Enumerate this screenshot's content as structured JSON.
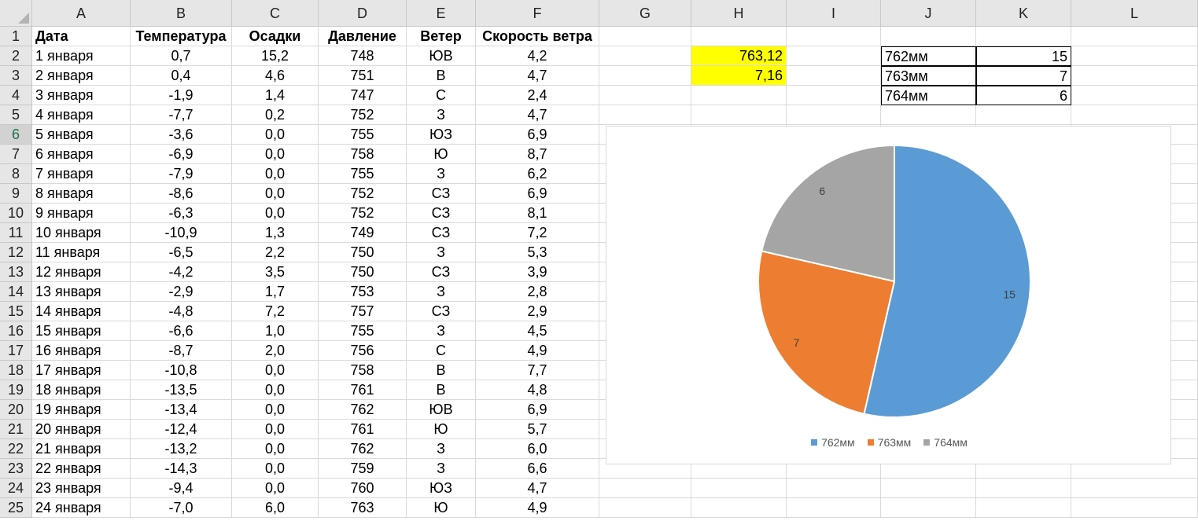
{
  "column_headers": [
    "A",
    "B",
    "C",
    "D",
    "E",
    "F",
    "G",
    "H",
    "I",
    "J",
    "K",
    "L"
  ],
  "row_numbers": [
    "1",
    "2",
    "3",
    "4",
    "5",
    "6",
    "7",
    "8",
    "9",
    "10",
    "11",
    "12",
    "13",
    "14",
    "15",
    "16",
    "17",
    "18",
    "19",
    "20",
    "21",
    "22",
    "23",
    "24",
    "25"
  ],
  "table": {
    "headers": [
      "Дата",
      "Температура",
      "Осадки",
      "Давление",
      "Ветер",
      "Скорость ветра"
    ],
    "rows": [
      [
        "1 января",
        "0,7",
        "15,2",
        "748",
        "ЮВ",
        "4,2"
      ],
      [
        "2 января",
        "0,4",
        "4,6",
        "751",
        "В",
        "4,7"
      ],
      [
        "3 января",
        "-1,9",
        "1,4",
        "747",
        "С",
        "2,4"
      ],
      [
        "4 января",
        "-7,7",
        "0,2",
        "752",
        "З",
        "4,7"
      ],
      [
        "5 января",
        "-3,6",
        "0,0",
        "755",
        "ЮЗ",
        "6,9"
      ],
      [
        "6 января",
        "-6,9",
        "0,0",
        "758",
        "Ю",
        "8,7"
      ],
      [
        "7 января",
        "-7,9",
        "0,0",
        "755",
        "З",
        "6,2"
      ],
      [
        "8 января",
        "-8,6",
        "0,0",
        "752",
        "СЗ",
        "6,9"
      ],
      [
        "9 января",
        "-6,3",
        "0,0",
        "752",
        "СЗ",
        "8,1"
      ],
      [
        "10 января",
        "-10,9",
        "1,3",
        "749",
        "СЗ",
        "7,2"
      ],
      [
        "11 января",
        "-6,5",
        "2,2",
        "750",
        "З",
        "5,3"
      ],
      [
        "12 января",
        "-4,2",
        "3,5",
        "750",
        "СЗ",
        "3,9"
      ],
      [
        "13 января",
        "-2,9",
        "1,7",
        "753",
        "З",
        "2,8"
      ],
      [
        "14 января",
        "-4,8",
        "7,2",
        "757",
        "СЗ",
        "2,9"
      ],
      [
        "15 января",
        "-6,6",
        "1,0",
        "755",
        "З",
        "4,5"
      ],
      [
        "16 января",
        "-8,7",
        "2,0",
        "756",
        "С",
        "4,9"
      ],
      [
        "17 января",
        "-10,8",
        "0,0",
        "758",
        "В",
        "7,7"
      ],
      [
        "18 января",
        "-13,5",
        "0,0",
        "761",
        "В",
        "4,8"
      ],
      [
        "19 января",
        "-13,4",
        "0,0",
        "762",
        "ЮВ",
        "6,9"
      ],
      [
        "20 января",
        "-12,4",
        "0,0",
        "761",
        "Ю",
        "5,7"
      ],
      [
        "21 января",
        "-13,2",
        "0,0",
        "762",
        "З",
        "6,0"
      ],
      [
        "22 января",
        "-14,3",
        "0,0",
        "759",
        "З",
        "6,6"
      ],
      [
        "23 января",
        "-9,4",
        "0,0",
        "760",
        "ЮЗ",
        "4,7"
      ],
      [
        "24 января",
        "-7,0",
        "6,0",
        "763",
        "Ю",
        "4,9"
      ]
    ]
  },
  "stats": {
    "h2": "763,12",
    "h3": "7,16"
  },
  "pressure_counts": [
    {
      "label": "762мм",
      "count": "15"
    },
    {
      "label": "763мм",
      "count": "7"
    },
    {
      "label": "764мм",
      "count": "6"
    }
  ],
  "active_row": "6",
  "chart_data": {
    "type": "pie",
    "categories": [
      "762мм",
      "763мм",
      "764мм"
    ],
    "values": [
      15,
      7,
      6
    ],
    "data_labels": [
      "15",
      "7",
      "6"
    ],
    "colors": [
      "#5b9bd5",
      "#ed7d31",
      "#a5a5a5"
    ],
    "title": "",
    "legend_position": "bottom"
  }
}
